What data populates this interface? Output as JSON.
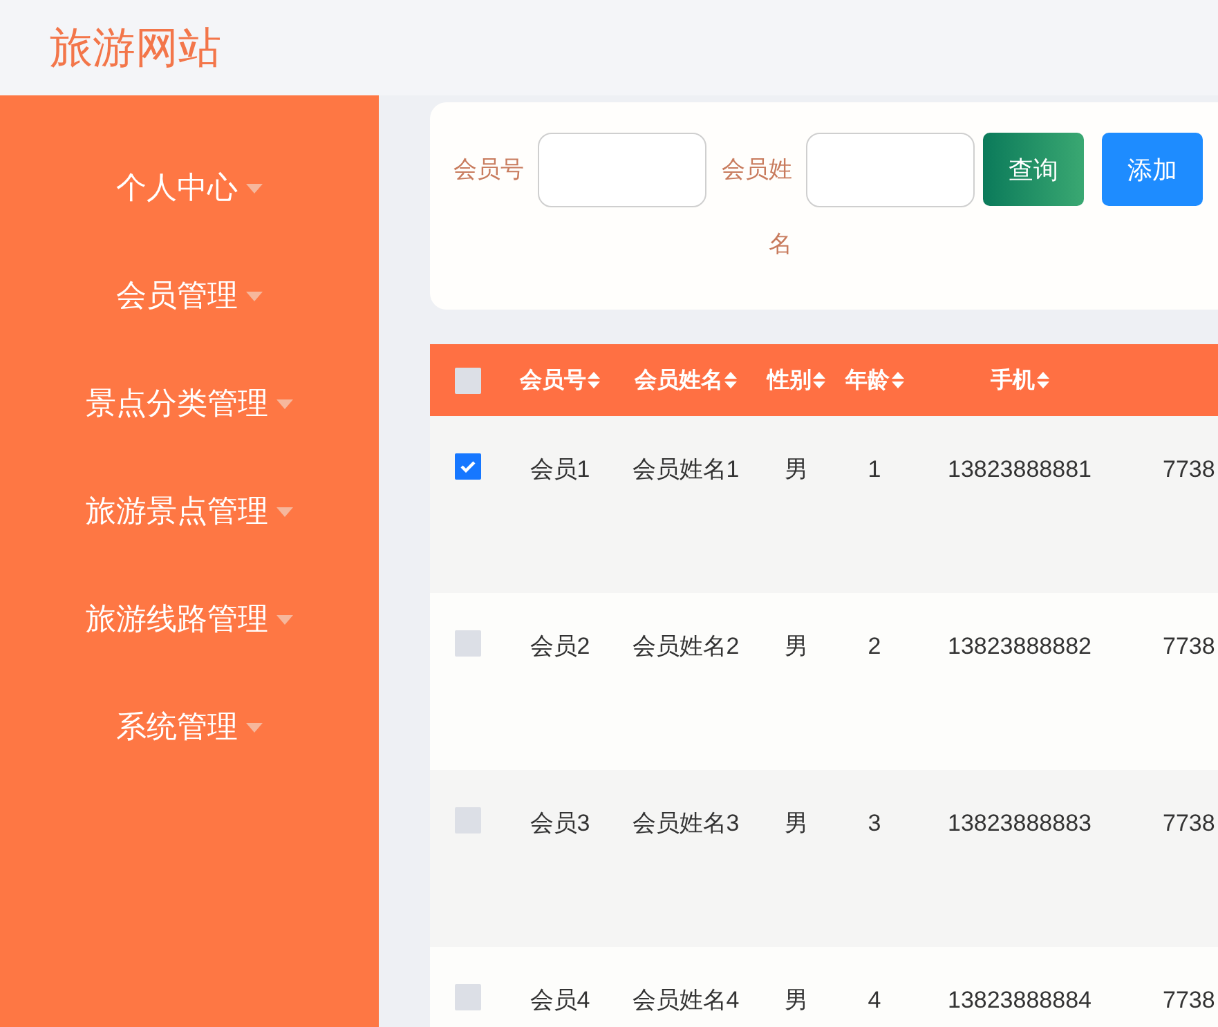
{
  "site_title": "旅游网站",
  "sidebar": {
    "items": [
      {
        "label": "个人中心"
      },
      {
        "label": "会员管理"
      },
      {
        "label": "景点分类管理"
      },
      {
        "label": "旅游景点管理"
      },
      {
        "label": "旅游线路管理"
      },
      {
        "label": "系统管理"
      }
    ]
  },
  "search": {
    "fields": [
      {
        "label": "会员号"
      },
      {
        "label": "会员姓名"
      }
    ],
    "buttons": [
      {
        "label": "查询",
        "kind": "search"
      },
      {
        "label": "添加",
        "kind": "add"
      }
    ]
  },
  "table": {
    "select_all": {
      "checked": false
    },
    "columns": [
      {
        "label": "会员号"
      },
      {
        "label": "会员姓名"
      },
      {
        "label": "性别"
      },
      {
        "label": "年龄"
      },
      {
        "label": "手机"
      }
    ],
    "rows": [
      {
        "checked": true,
        "cells": [
          "会员1",
          "会员姓名1",
          "男",
          "1",
          "13823888881",
          "7738"
        ]
      },
      {
        "checked": false,
        "cells": [
          "会员2",
          "会员姓名2",
          "男",
          "2",
          "13823888882",
          "7738"
        ]
      },
      {
        "checked": false,
        "cells": [
          "会员3",
          "会员姓名3",
          "男",
          "3",
          "13823888883",
          "7738"
        ]
      },
      {
        "checked": false,
        "cells": [
          "会员4",
          "会员姓名4",
          "男",
          "4",
          "13823888884",
          "7738"
        ]
      }
    ]
  }
}
